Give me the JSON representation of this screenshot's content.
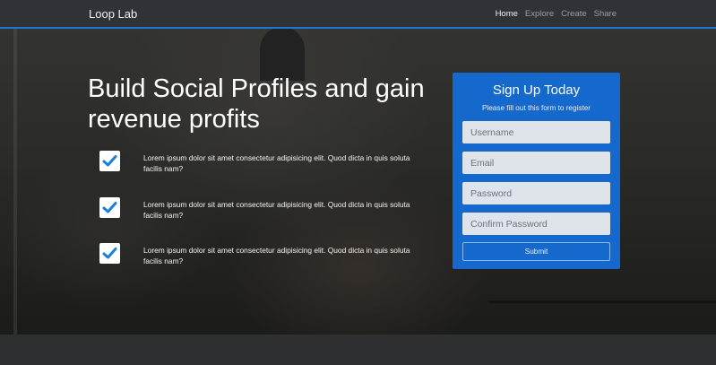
{
  "navbar": {
    "brand": "Loop Lab",
    "links": [
      {
        "label": "Home",
        "active": true
      },
      {
        "label": "Explore",
        "active": false
      },
      {
        "label": "Create",
        "active": false
      },
      {
        "label": "Share",
        "active": false
      }
    ]
  },
  "hero": {
    "headline": {
      "part1": "Build ",
      "part2": "Social Profiles",
      "part3": " and gain revenue profits"
    },
    "features": [
      {
        "text": "Lorem ipsum dolor sit amet consectetur adipisicing elit. Quod dicta in quis soluta facilis nam?",
        "icon": "checkmark-icon"
      },
      {
        "text": "Lorem ipsum dolor sit amet consectetur adipisicing elit. Quod dicta in quis soluta facilis nam?",
        "icon": "checkmark-icon"
      },
      {
        "text": "Lorem ipsum dolor sit amet consectetur adipisicing elit. Quod dicta in quis soluta facilis nam?",
        "icon": "checkmark-icon"
      }
    ]
  },
  "signup": {
    "title": "Sign Up Today",
    "subtitle": "Please fill out this form to register",
    "fields": {
      "username": {
        "placeholder": "Username",
        "value": ""
      },
      "email": {
        "placeholder": "Email",
        "value": ""
      },
      "password": {
        "placeholder": "Password",
        "value": ""
      },
      "confirm_password": {
        "placeholder": "Confirm Password",
        "value": ""
      }
    },
    "submit_label": "Submit"
  },
  "colors": {
    "accent": "#1669cc",
    "nav_border": "#1f7ad6",
    "check": "#1a7fd8"
  }
}
